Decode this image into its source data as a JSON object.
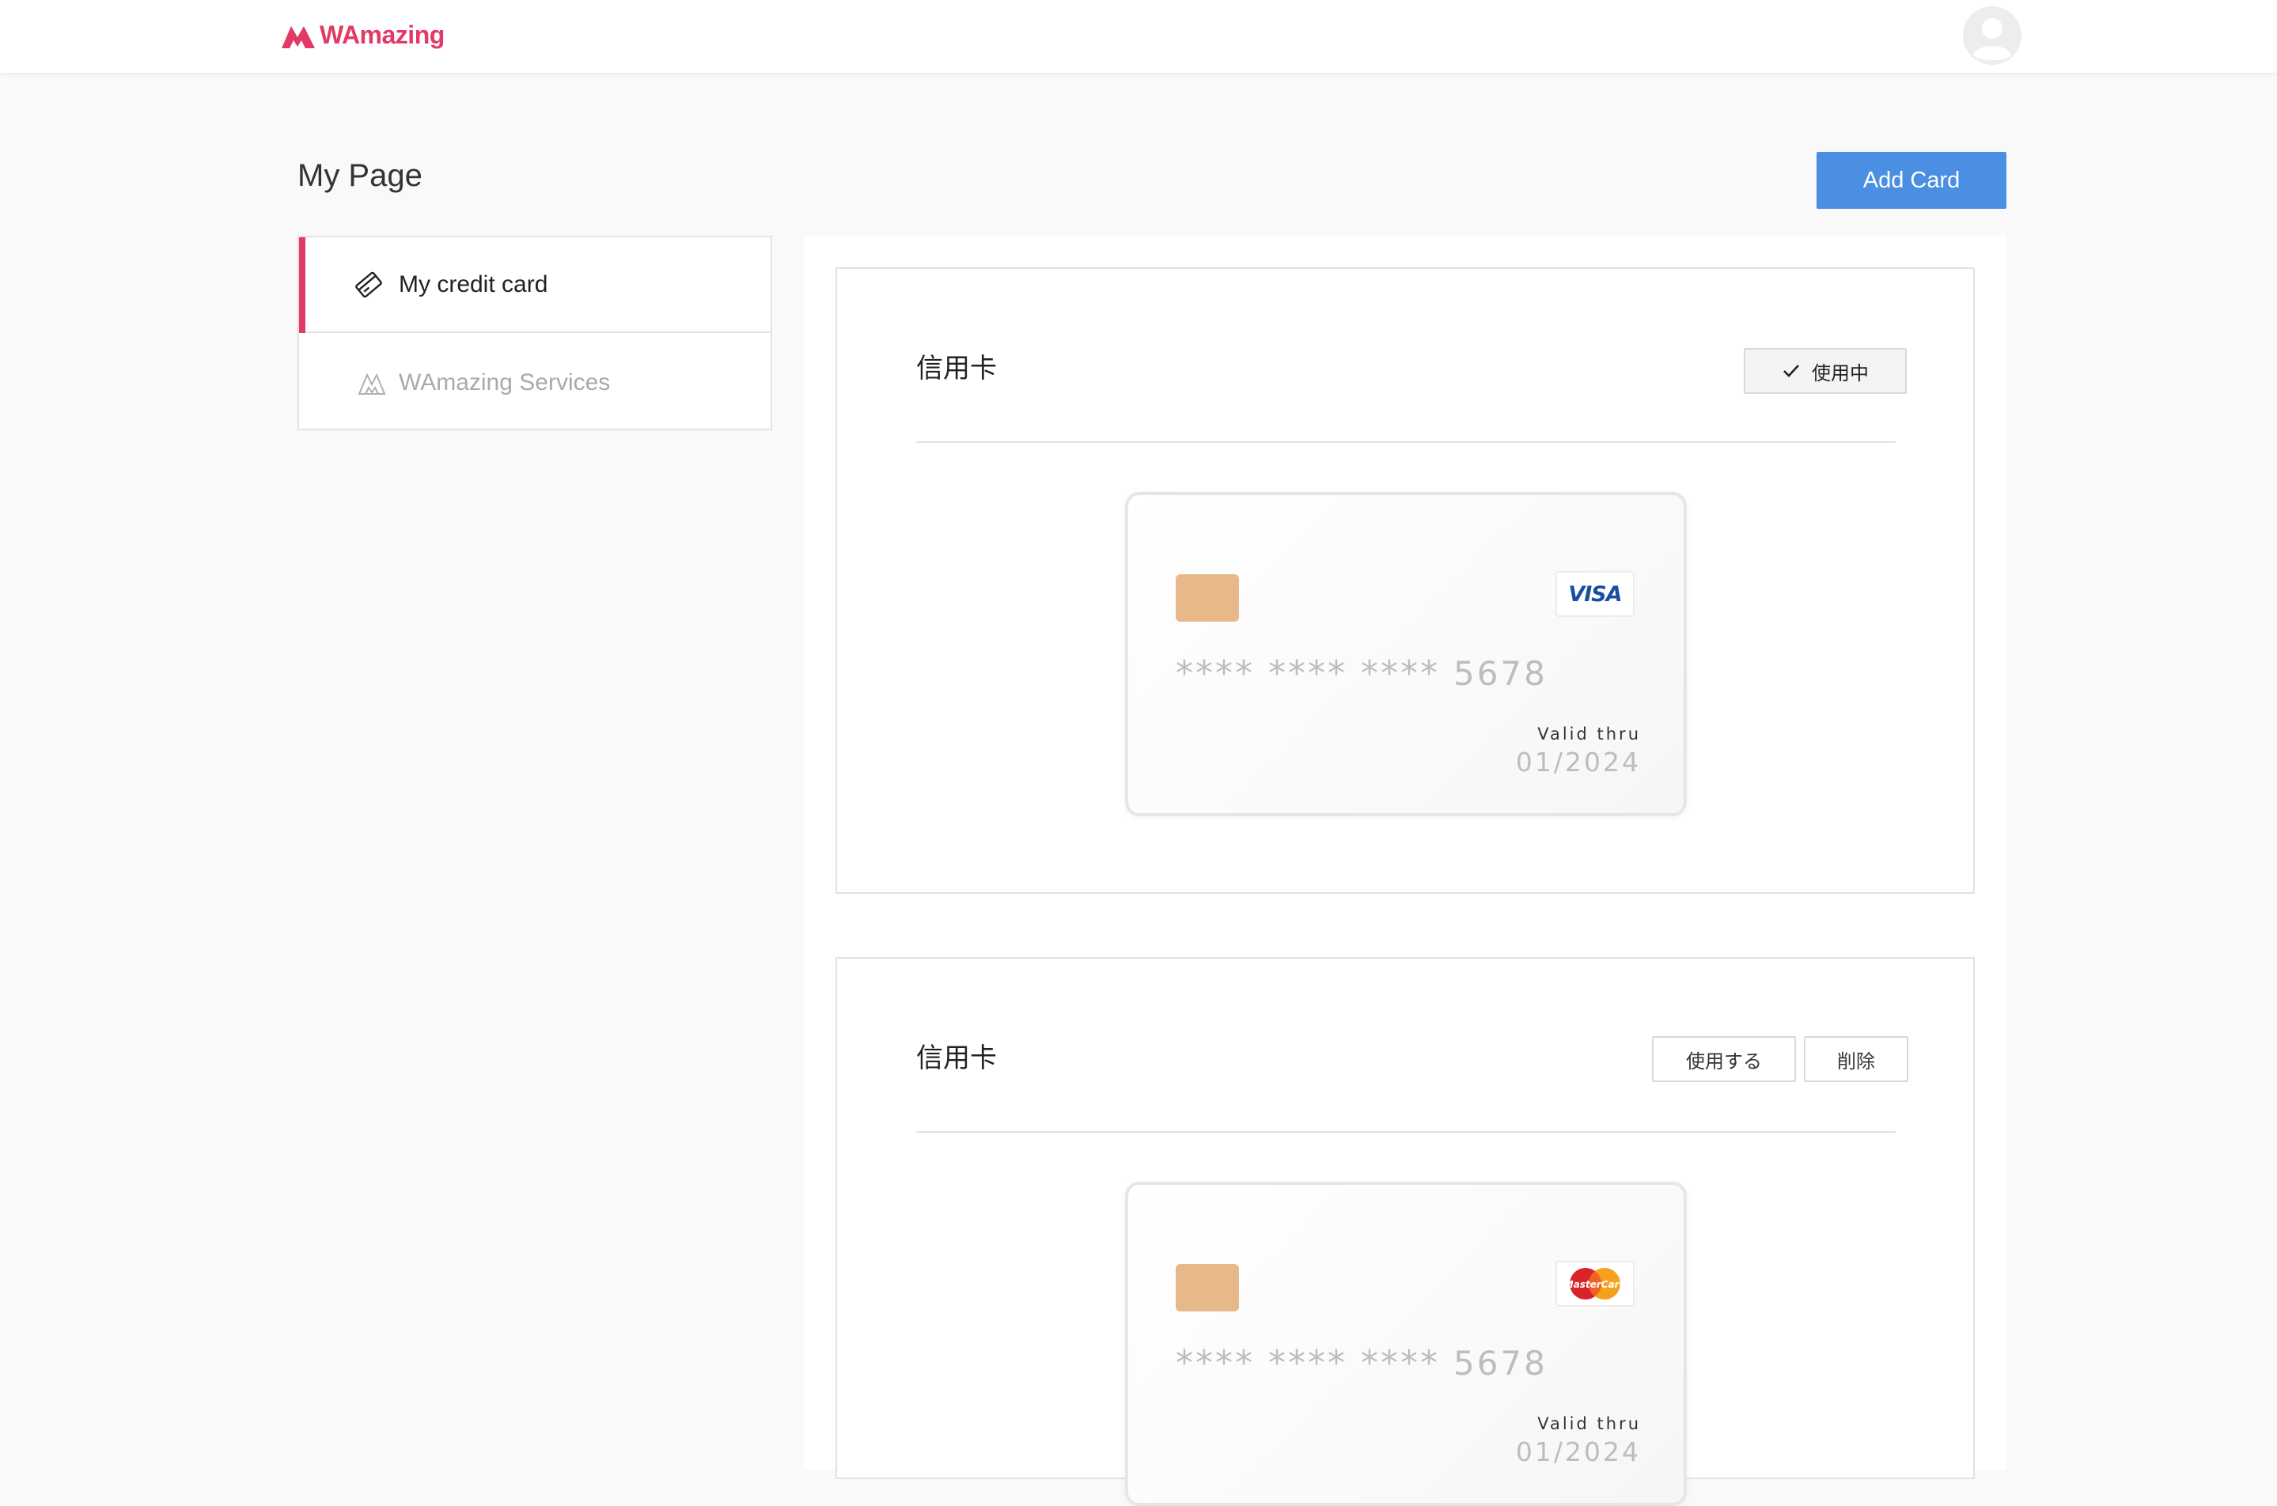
{
  "header": {
    "logo_text": "WAmazing",
    "brand_color": "#e23a64"
  },
  "page": {
    "title": "My Page",
    "add_card_label": "Add Card",
    "accent_color": "#4a8fe2"
  },
  "sidebar": {
    "items": [
      {
        "label": "My credit card",
        "icon": "credit-card-icon",
        "active": true
      },
      {
        "label": "WAmazing Services",
        "icon": "wamazing-services-icon",
        "active": false
      }
    ]
  },
  "cards": [
    {
      "section_title": "信用卡",
      "status_label": "使用中",
      "brand": "VISA",
      "number_masked": "**** **** ****",
      "number_last4": "5678",
      "valid_label": "Valid thru",
      "valid_date": "01/2024"
    },
    {
      "section_title": "信用卡",
      "use_label": "使用する",
      "delete_label": "削除",
      "brand": "MasterCard",
      "number_masked": "**** **** ****",
      "number_last4": "5678",
      "valid_label": "Valid thru",
      "valid_date": "01/2024"
    }
  ]
}
